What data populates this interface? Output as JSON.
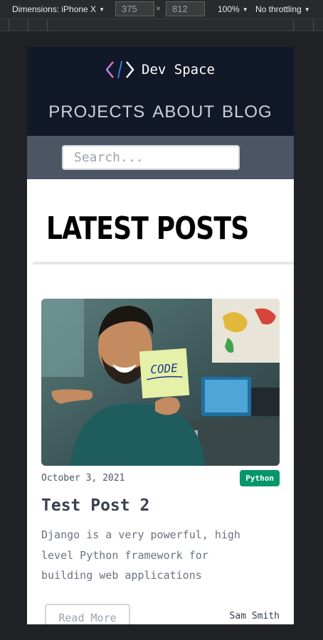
{
  "devtools": {
    "dimensions_label": "Dimensions: iPhone X",
    "width_value": "375",
    "height_value": "812",
    "times": "×",
    "zoom": "100%",
    "throttling": "No throttling"
  },
  "site": {
    "brand": "Dev Space",
    "nav": [
      "PROJECTS",
      "ABOUT",
      "BLOG"
    ],
    "search_placeholder": "Search..."
  },
  "main": {
    "heading": "LATEST POSTS"
  },
  "post": {
    "image_alt": "Man pointing at a sticky note that says CODE",
    "sticky_note": "CODE",
    "date": "October 3, 2021",
    "tag": "Python",
    "title": "Test Post 2",
    "excerpt": "Django is a very powerful, high level Python framework for building web applications",
    "read_more": "Read More",
    "author": "Sam Smith"
  },
  "colors": {
    "header_bg": "#111827",
    "search_band": "#4b5563",
    "tag_green": "#059669"
  }
}
